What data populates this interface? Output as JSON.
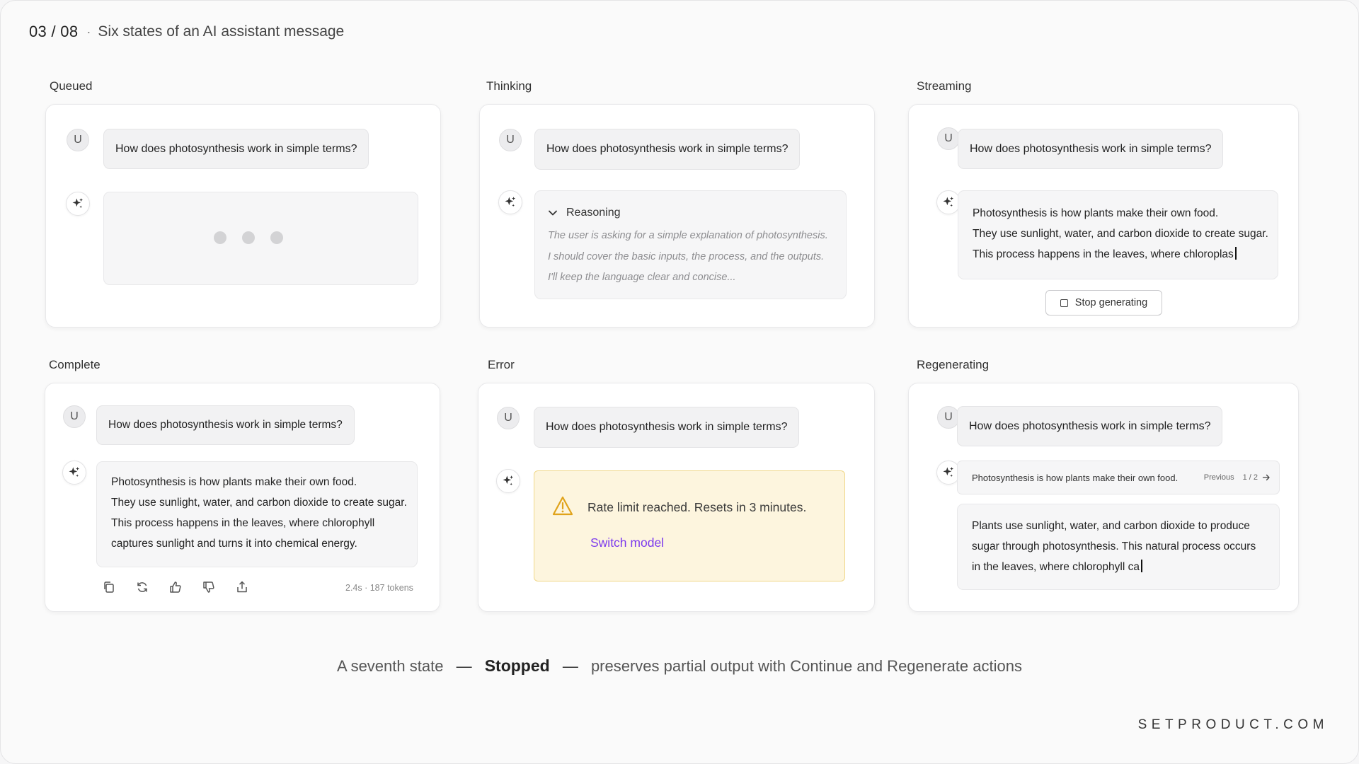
{
  "header": {
    "page_counter": "03 / 08",
    "separator": "·",
    "title": "Six states of an AI assistant message"
  },
  "user_initial": "U",
  "user_question": "How does photosynthesis work in simple terms?",
  "panels": {
    "queued": {
      "label": "Queued"
    },
    "thinking": {
      "label": "Thinking",
      "reasoning_title": "Reasoning",
      "reasoning_lines": [
        "The user is asking for a simple explanation of photosynthesis.",
        "I should cover the basic inputs, the process, and the outputs.",
        "I'll keep the language clear and concise..."
      ]
    },
    "streaming": {
      "label": "Streaming",
      "lines": [
        "Photosynthesis is how plants make their own food.",
        "They use sunlight, water, and carbon dioxide to create sugar.",
        "This process happens in the leaves, where chloroplas"
      ],
      "stop_label": "Stop generating"
    },
    "complete": {
      "label": "Complete",
      "lines": [
        "Photosynthesis is how plants make their own food.",
        "They use sunlight, water, and carbon dioxide to create sugar.",
        "This process happens in the leaves, where chlorophyll",
        "captures sunlight and turns it into chemical energy."
      ],
      "meta": "2.4s · 187 tokens",
      "actions": [
        "copy-icon",
        "regenerate-icon",
        "thumbs-up-icon",
        "thumbs-down-icon",
        "share-icon"
      ]
    },
    "error": {
      "label": "Error",
      "message": "Rate limit reached. Resets in 3 minutes.",
      "link": "Switch model",
      "colors": {
        "background": "#fdf5de",
        "border": "#f0d88a",
        "icon": "#e0a31a",
        "link": "#7c3aed"
      }
    },
    "regenerating": {
      "label": "Regenerating",
      "previous_text": "Photosynthesis is how plants make their own food.",
      "previous_label": "Previous",
      "page": "1 / 2",
      "lines": [
        "Plants use sunlight, water, and carbon dioxide to produce",
        "sugar through photosynthesis. This natural process occurs",
        "in the leaves, where chlorophyll ca"
      ]
    }
  },
  "footer": {
    "pre": "A seventh state",
    "dash": "—",
    "bold": "Stopped",
    "post": "preserves partial output with Continue and Regenerate actions",
    "brand": "SETPRODUCT.COM"
  }
}
